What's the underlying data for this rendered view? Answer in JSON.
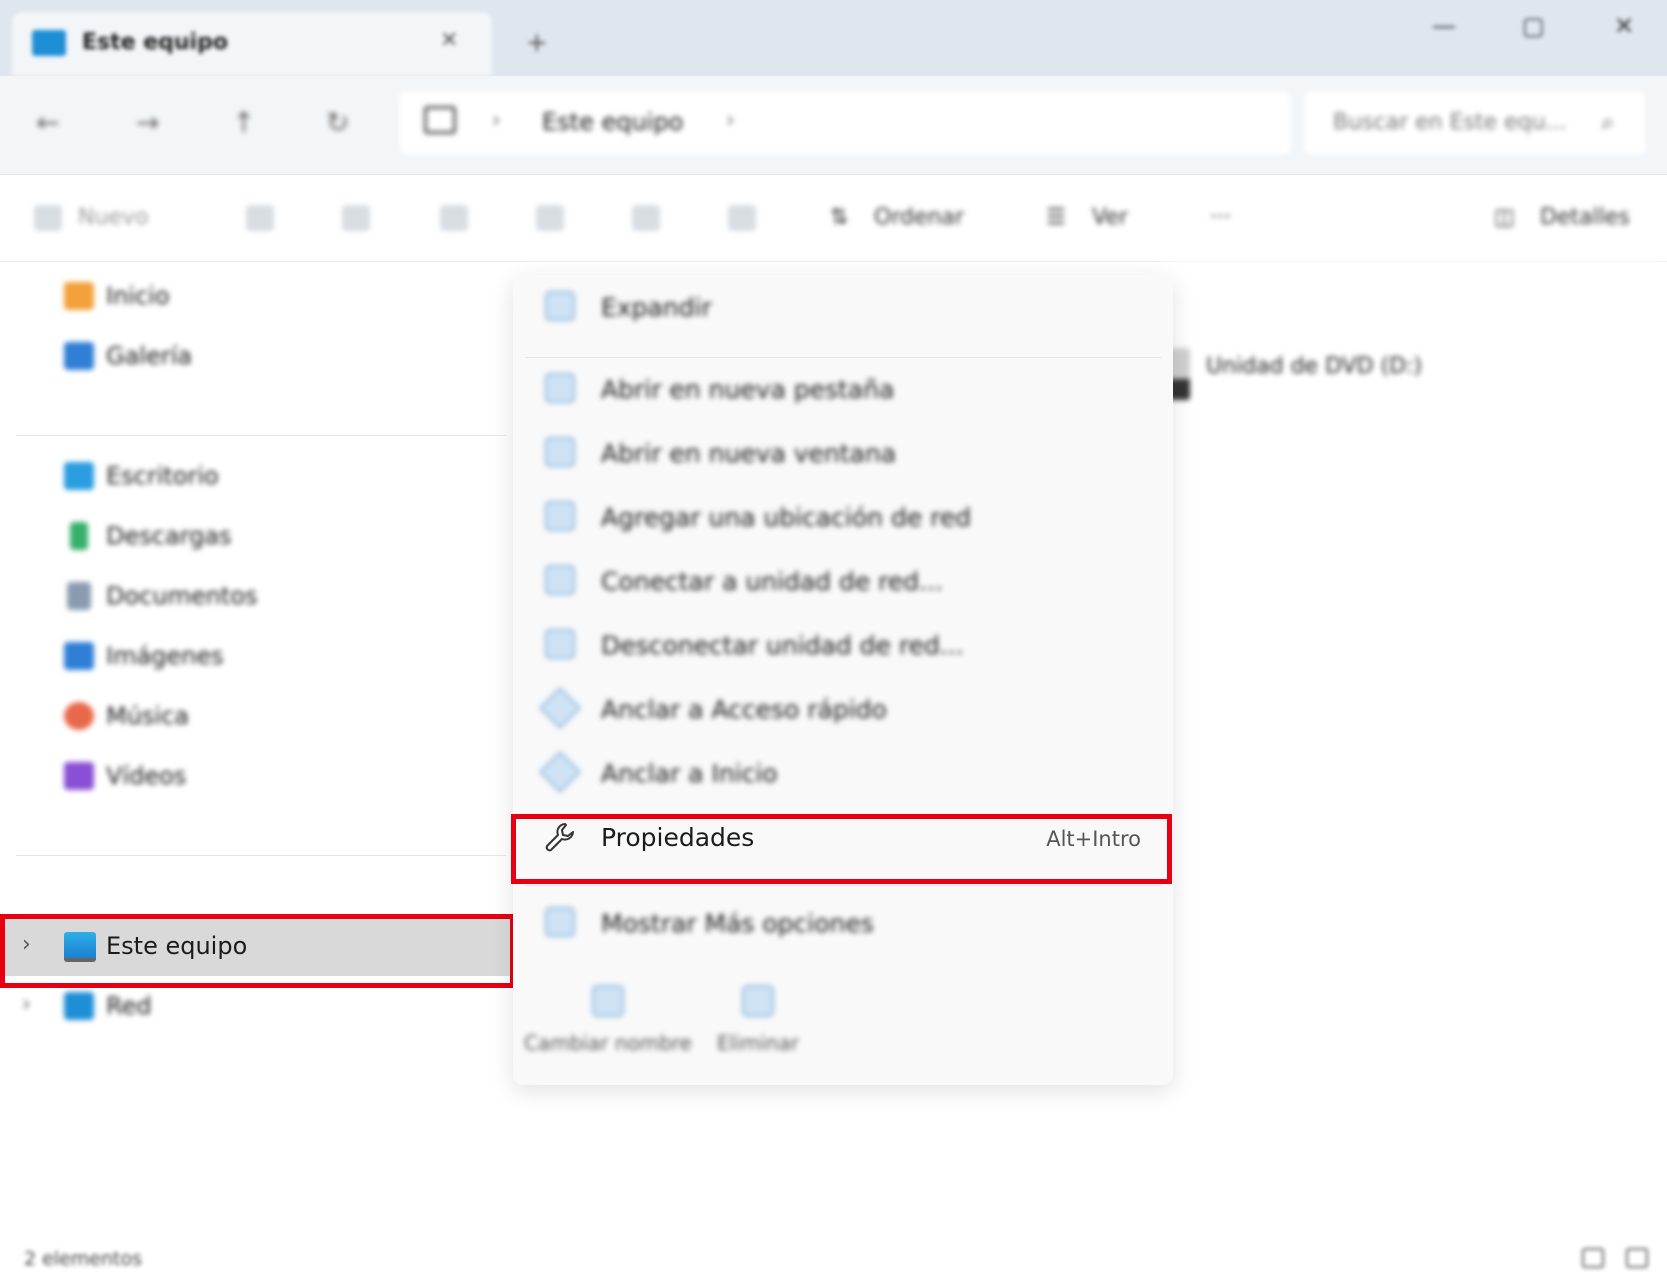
{
  "window": {
    "tab_title": "Este equipo",
    "tab_close": "✕",
    "new_tab": "+",
    "minimize": "—",
    "maximize": "▢",
    "close": "✕"
  },
  "nav": {
    "back": "←",
    "forward": "→",
    "up": "↑",
    "refresh": "↻",
    "chevron": "›",
    "breadcrumb": "Este equipo",
    "search_placeholder": "Buscar en Este equ..."
  },
  "commands": {
    "new_label": "Nuevo",
    "sort_label": "Ordenar",
    "view_label": "Ver",
    "more": "···",
    "details_label": "Detalles"
  },
  "sidebar": {
    "items": [
      {
        "label": "Inicio",
        "icon": "home-icon",
        "color": "#f2a13b"
      },
      {
        "label": "Galería",
        "icon": "gallery-icon",
        "color": "#2f7fd6"
      },
      {
        "label": "Escritorio",
        "icon": "desktop-folder-icon",
        "color": "#2a9de0"
      },
      {
        "label": "Descargas",
        "icon": "download-icon",
        "color": "#35b06a"
      },
      {
        "label": "Documentos",
        "icon": "documents-icon",
        "color": "#8a9bb0"
      },
      {
        "label": "Imágenes",
        "icon": "pictures-icon",
        "color": "#2f7fd6"
      },
      {
        "label": "Música",
        "icon": "music-icon",
        "color": "#e8684a"
      },
      {
        "label": "Vídeos",
        "icon": "videos-icon",
        "color": "#8a4fd6"
      },
      {
        "label": "Este equipo",
        "icon": "this-pc-icon",
        "color": "#1e8fd6",
        "chevron": "›"
      },
      {
        "label": "Red",
        "icon": "network-icon",
        "color": "#1e8fd6",
        "chevron": "›"
      }
    ]
  },
  "content": {
    "drive_label": "Unidad de DVD (D:)"
  },
  "context_menu": {
    "items": [
      {
        "label": "Expandir"
      },
      {
        "label": "Abrir en nueva pestaña"
      },
      {
        "label": "Abrir en nueva ventana"
      },
      {
        "label": "Agregar una ubicación de red"
      },
      {
        "label": "Conectar a unidad de red..."
      },
      {
        "label": "Desconectar unidad de red..."
      },
      {
        "label": "Anclar a Acceso rápido"
      },
      {
        "label": "Anclar a Inicio"
      },
      {
        "label": "Propiedades",
        "shortcut": "Alt+Intro"
      },
      {
        "label": "Mostrar Más opciones"
      }
    ],
    "actions": [
      {
        "label": "Cambiar nombre"
      },
      {
        "label": "Eliminar"
      }
    ]
  },
  "status": {
    "item_count": "2 elementos"
  },
  "colors": {
    "highlight_red": "#e60012",
    "selected_bg": "#d9d9d9"
  }
}
